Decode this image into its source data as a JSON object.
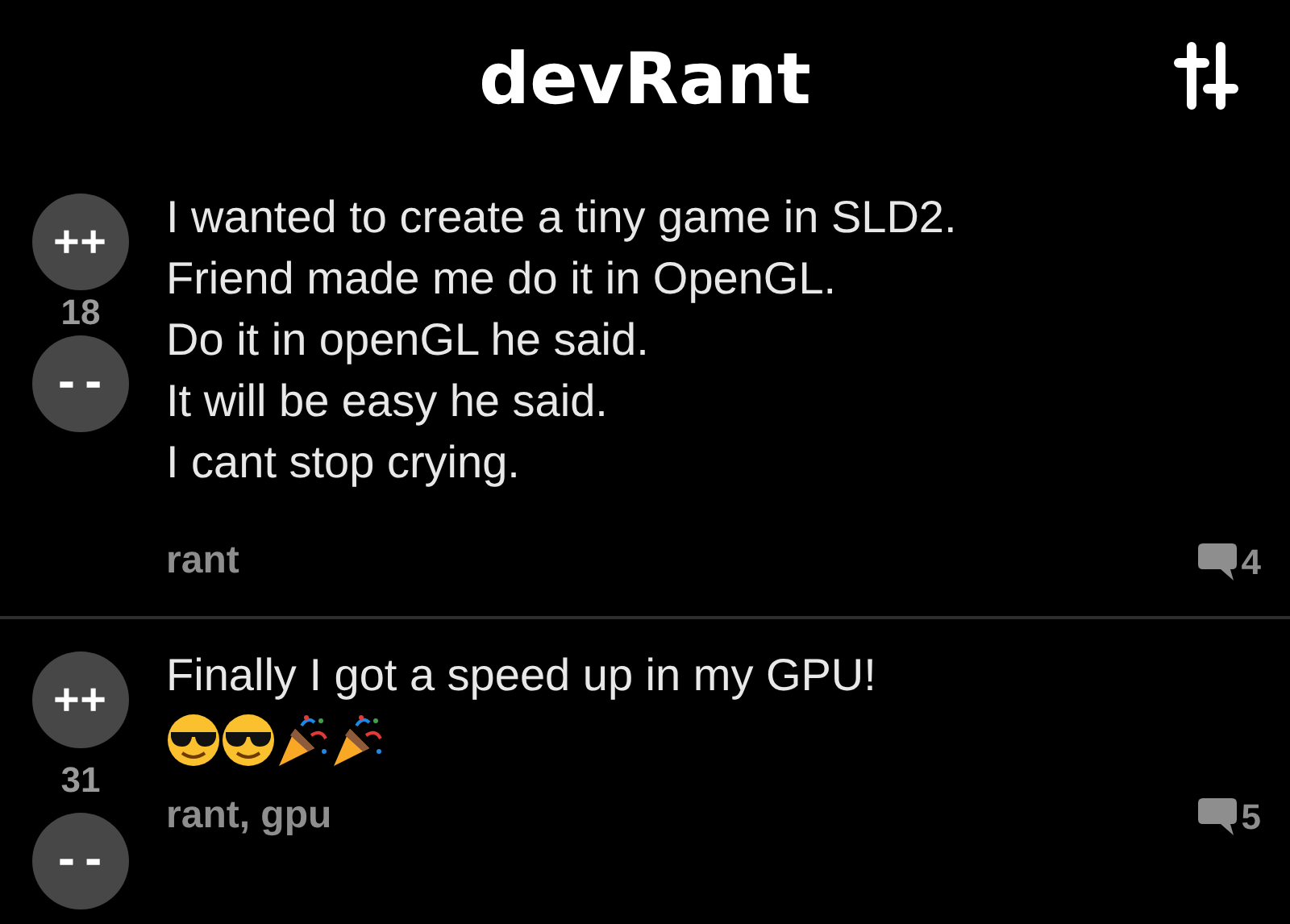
{
  "header": {
    "title": "devRant"
  },
  "posts": [
    {
      "upvote": "++",
      "score": "18",
      "downvote": "--",
      "text": "I wanted to create a tiny game in SLD2.\nFriend made me do it in OpenGL.\nDo it in openGL he said.\nIt will be easy he said.\nI cant stop crying.",
      "tags": "rant",
      "comments": "4"
    },
    {
      "upvote": "++",
      "score": "31",
      "downvote": "--",
      "text": "Finally I got a speed up in my GPU!",
      "emojis": [
        {
          "kind": "sunglasses"
        },
        {
          "kind": "sunglasses"
        },
        {
          "kind": "party"
        },
        {
          "kind": "party"
        }
      ],
      "tags": "rant, gpu",
      "comments": "5"
    }
  ]
}
